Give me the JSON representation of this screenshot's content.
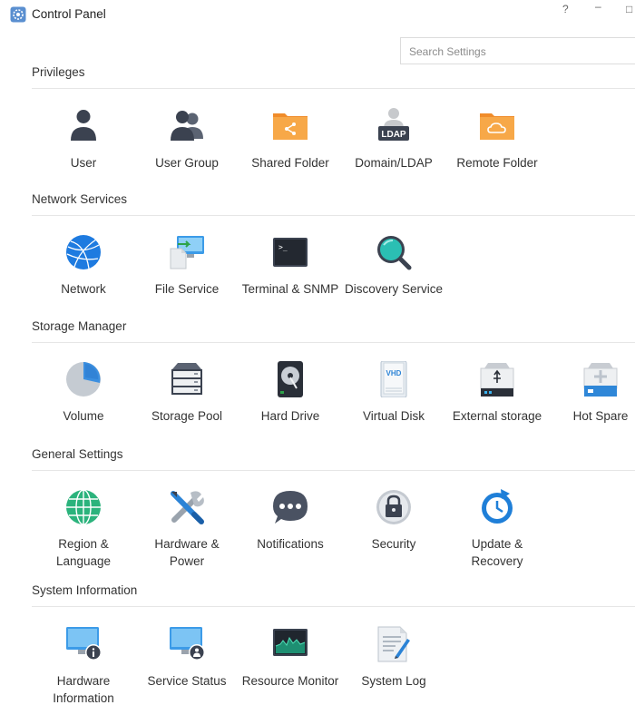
{
  "window": {
    "title": "Control Panel",
    "help": "?",
    "minimize": "–",
    "maximize": "□"
  },
  "search": {
    "placeholder": "Search Settings"
  },
  "sections": [
    {
      "title": "Privileges",
      "items": [
        {
          "label": "User",
          "icon": "user-icon"
        },
        {
          "label": "User Group",
          "icon": "user-group-icon"
        },
        {
          "label": "Shared Folder",
          "icon": "shared-folder-icon"
        },
        {
          "label": "Domain/LDAP",
          "icon": "domain-ldap-icon",
          "badge": "LDAP"
        },
        {
          "label": "Remote Folder",
          "icon": "remote-folder-icon"
        }
      ]
    },
    {
      "title": "Network Services",
      "items": [
        {
          "label": "Network",
          "icon": "network-globe-icon"
        },
        {
          "label": "File Service",
          "icon": "file-service-icon"
        },
        {
          "label": "Terminal & SNMP",
          "icon": "terminal-icon",
          "prompt": ">_"
        },
        {
          "label": "Discovery Service",
          "icon": "magnifier-icon"
        }
      ]
    },
    {
      "title": "Storage Manager",
      "items": [
        {
          "label": "Volume",
          "icon": "volume-pie-icon"
        },
        {
          "label": "Storage Pool",
          "icon": "storage-pool-icon"
        },
        {
          "label": "Hard Drive",
          "icon": "hard-drive-icon"
        },
        {
          "label": "Virtual Disk",
          "icon": "virtual-disk-icon",
          "badge": "VHD"
        },
        {
          "label": "External storage",
          "icon": "external-storage-icon"
        },
        {
          "label": "Hot Spare",
          "icon": "hot-spare-icon"
        }
      ]
    },
    {
      "title": "General Settings",
      "items": [
        {
          "label": "Region & Language",
          "icon": "region-globe-icon"
        },
        {
          "label": "Hardware & Power",
          "icon": "tools-icon"
        },
        {
          "label": "Notifications",
          "icon": "chat-bubble-icon"
        },
        {
          "label": "Security",
          "icon": "lock-icon"
        },
        {
          "label": "Update & Recovery",
          "icon": "update-clock-icon"
        }
      ]
    },
    {
      "title": "System Information",
      "items": [
        {
          "label": "Hardware Information",
          "icon": "monitor-info-icon"
        },
        {
          "label": "Service Status",
          "icon": "monitor-user-icon"
        },
        {
          "label": "Resource Monitor",
          "icon": "resource-monitor-icon"
        },
        {
          "label": "System Log",
          "icon": "system-log-icon"
        }
      ]
    }
  ],
  "colors": {
    "orange": "#f5a33c",
    "blue": "#2b83d6",
    "dark": "#3b4250",
    "green": "#2eb88a"
  }
}
